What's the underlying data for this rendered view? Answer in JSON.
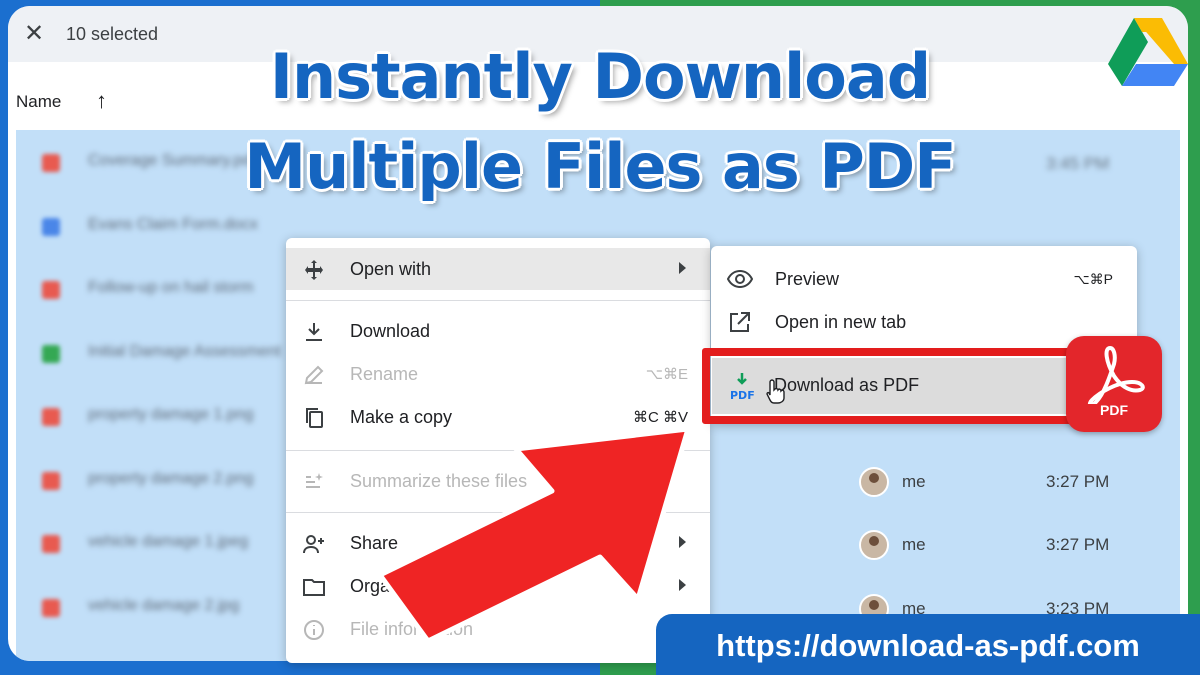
{
  "selection_bar": {
    "count_text": "10 selected"
  },
  "columns": {
    "name": "Name"
  },
  "files": [
    {
      "name": "Coverage Summary.pdf",
      "time": "3:45 PM",
      "owner": "",
      "icon_color": "#e85a50",
      "blurred": true
    },
    {
      "name": "Evans Claim Form.docx",
      "time": "",
      "owner": "",
      "icon_color": "#4a86e8",
      "blurred": true
    },
    {
      "name": "Follow-up on hail storm",
      "time": "",
      "owner": "",
      "icon_color": "#e85a50",
      "blurred": true
    },
    {
      "name": "Initial Damage Assessment",
      "time": "",
      "owner": "",
      "icon_color": "#34a853",
      "blurred": true
    },
    {
      "name": "property damage 1.png",
      "time": "",
      "owner": "",
      "icon_color": "#e85a50",
      "blurred": true
    },
    {
      "name": "property damage 2.png",
      "time": "3:27 PM",
      "owner": "me",
      "icon_color": "#e85a50",
      "blurred": false
    },
    {
      "name": "vehicle damage 1.jpeg",
      "time": "3:27 PM",
      "owner": "me",
      "icon_color": "#e85a50",
      "blurred": false
    },
    {
      "name": "vehicle damage 2.jpg",
      "time": "3:23 PM",
      "owner": "me",
      "icon_color": "#e85a50",
      "blurred": false
    }
  ],
  "headline": {
    "line1": "Instantly Download",
    "line2": "Multiple Files as PDF"
  },
  "context_menu": {
    "open_with": {
      "label": "Open with",
      "icon": "move-icon"
    },
    "download": {
      "label": "Download",
      "icon": "download-icon"
    },
    "rename": {
      "label": "Rename",
      "shortcut": "⌥⌘E",
      "icon": "pencil-icon"
    },
    "make_copy": {
      "label": "Make a copy",
      "shortcut": "⌘C ⌘V",
      "icon": "copy-icon"
    },
    "summarize": {
      "label": "Summarize these files",
      "icon": "sparkle-list-icon"
    },
    "share": {
      "label": "Share",
      "icon": "add-person-icon"
    },
    "organize": {
      "label": "Organize",
      "icon": "folder-icon"
    },
    "file_info": {
      "label": "File information",
      "icon": "info-icon"
    }
  },
  "submenu": {
    "preview": {
      "label": "Preview",
      "shortcut": "⌥⌘P",
      "icon": "eye-icon"
    },
    "open_new_tab": {
      "label": "Open in new tab",
      "icon": "external-link-icon"
    },
    "download_pdf": {
      "label": "Download as PDF",
      "icon": "pdf-download-icon"
    }
  },
  "acrobat_badge": {
    "label": "PDF"
  },
  "url_banner": {
    "text": "https://download-as-pdf.com"
  },
  "colors": {
    "accent_blue": "#1565c0",
    "highlight_red": "#e31d1d",
    "selection_blue": "#c2dff8",
    "acrobat_red": "#e3262b"
  }
}
